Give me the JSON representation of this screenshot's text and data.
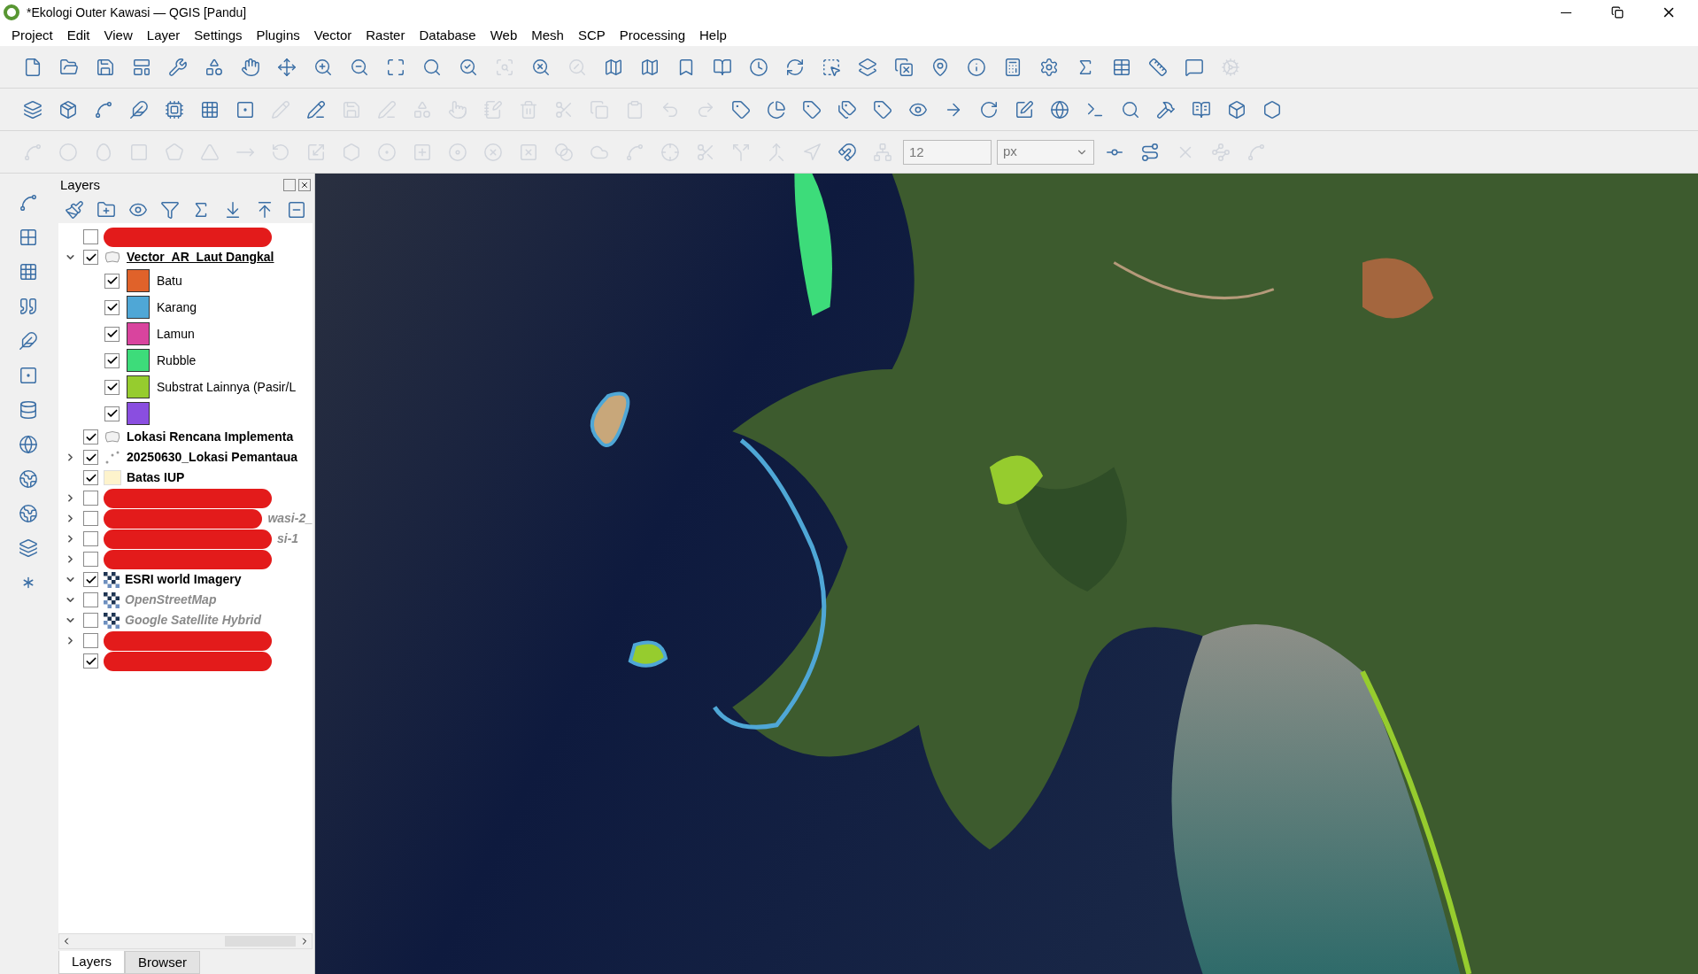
{
  "window": {
    "title": "*Ekologi Outer Kawasi — QGIS [Pandu]"
  },
  "menu": [
    "Project",
    "Edit",
    "View",
    "Layer",
    "Settings",
    "Plugins",
    "Vector",
    "Raster",
    "Database",
    "Web",
    "Mesh",
    "SCP",
    "Processing",
    "Help"
  ],
  "snapping": {
    "tolerance": "12",
    "unit": "px"
  },
  "layers_panel": {
    "title": "Layers",
    "layers": [
      {
        "kind": "redacted",
        "checked": false
      },
      {
        "kind": "polygon",
        "name": "Vector_AR_Laut Dangkal",
        "checked": true,
        "expanded": true,
        "current": true,
        "greyed": false,
        "children": [
          {
            "label": "Batu",
            "color": "#e0622a",
            "checked": true
          },
          {
            "label": "Karang",
            "color": "#4fa7d6",
            "checked": true
          },
          {
            "label": "Lamun",
            "color": "#d9449e",
            "checked": true
          },
          {
            "label": "Rubble",
            "color": "#3ddc7a",
            "checked": true
          },
          {
            "label": "Substrat Lainnya (Pasir/L",
            "color": "#96cc2e",
            "checked": true
          },
          {
            "color": "#8a4ee0",
            "checked": true
          }
        ]
      },
      {
        "kind": "polygon",
        "name": "Lokasi Rencana Implementa",
        "checked": true,
        "current": false,
        "greyed": false
      },
      {
        "kind": "point",
        "name": "20250630_Lokasi Pemantaua",
        "checked": true,
        "expanded": false,
        "current": false,
        "greyed": false
      },
      {
        "kind": "fill",
        "name": "Batas IUP",
        "checked": true,
        "current": false,
        "greyed": false
      },
      {
        "kind": "redacted",
        "checked": false,
        "expanded": false
      },
      {
        "kind": "redacted",
        "checked": false,
        "expanded": false,
        "fragment": "wasi-2_"
      },
      {
        "kind": "redacted",
        "checked": false,
        "expanded": false,
        "fragment": "si-1"
      },
      {
        "kind": "redacted",
        "checked": false,
        "expanded": false
      },
      {
        "kind": "raster",
        "name": "ESRI world Imagery",
        "checked": true,
        "expanded": true,
        "current": false,
        "greyed": false
      },
      {
        "kind": "raster",
        "name": "OpenStreetMap",
        "checked": false,
        "expanded": true,
        "current": false,
        "greyed": true
      },
      {
        "kind": "raster",
        "name": "Google Satellite Hybrid",
        "checked": false,
        "expanded": true,
        "current": false,
        "greyed": true
      },
      {
        "kind": "redacted",
        "checked": false,
        "expanded": false
      },
      {
        "kind": "redacted",
        "checked": true
      }
    ]
  },
  "bottom_tabs": [
    {
      "label": "Layers",
      "selected": true
    },
    {
      "label": "Browser",
      "selected": false
    }
  ]
}
